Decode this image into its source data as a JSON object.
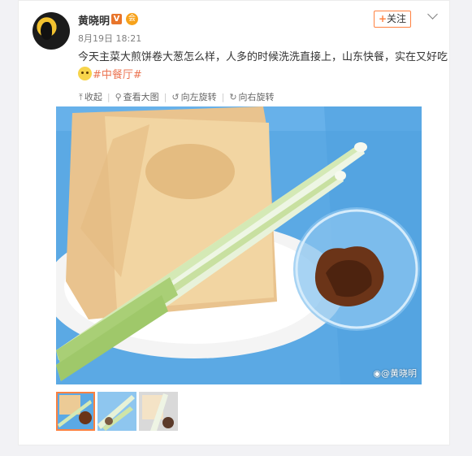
{
  "post": {
    "username": "黄晓明",
    "verified_badge": "V",
    "member_badge": "会",
    "timestamp": "8月19日 18:21",
    "follow_label": "关注",
    "follow_plus": "+",
    "text": "今天主菜大煎饼卷大葱怎么样，人多的时候洗洗直接上，山东快餐，实在又好吃",
    "topic_tag": "#中餐厅#"
  },
  "toolbar": {
    "collapse": "收起",
    "view_large": "查看大图",
    "rotate_left": "向左旋转",
    "rotate_right": "向右旋转"
  },
  "photo": {
    "watermark": "@黄晓明"
  },
  "icons": {
    "collapse": "arrow-up-icon",
    "view_large": "magnifier-icon",
    "rotate_left": "rotate-left-icon",
    "rotate_right": "rotate-right-icon",
    "more": "chevron-down-icon"
  },
  "colors": {
    "accent": "#ff8140",
    "tag": "#eb7350",
    "vip": "#e8752b"
  }
}
